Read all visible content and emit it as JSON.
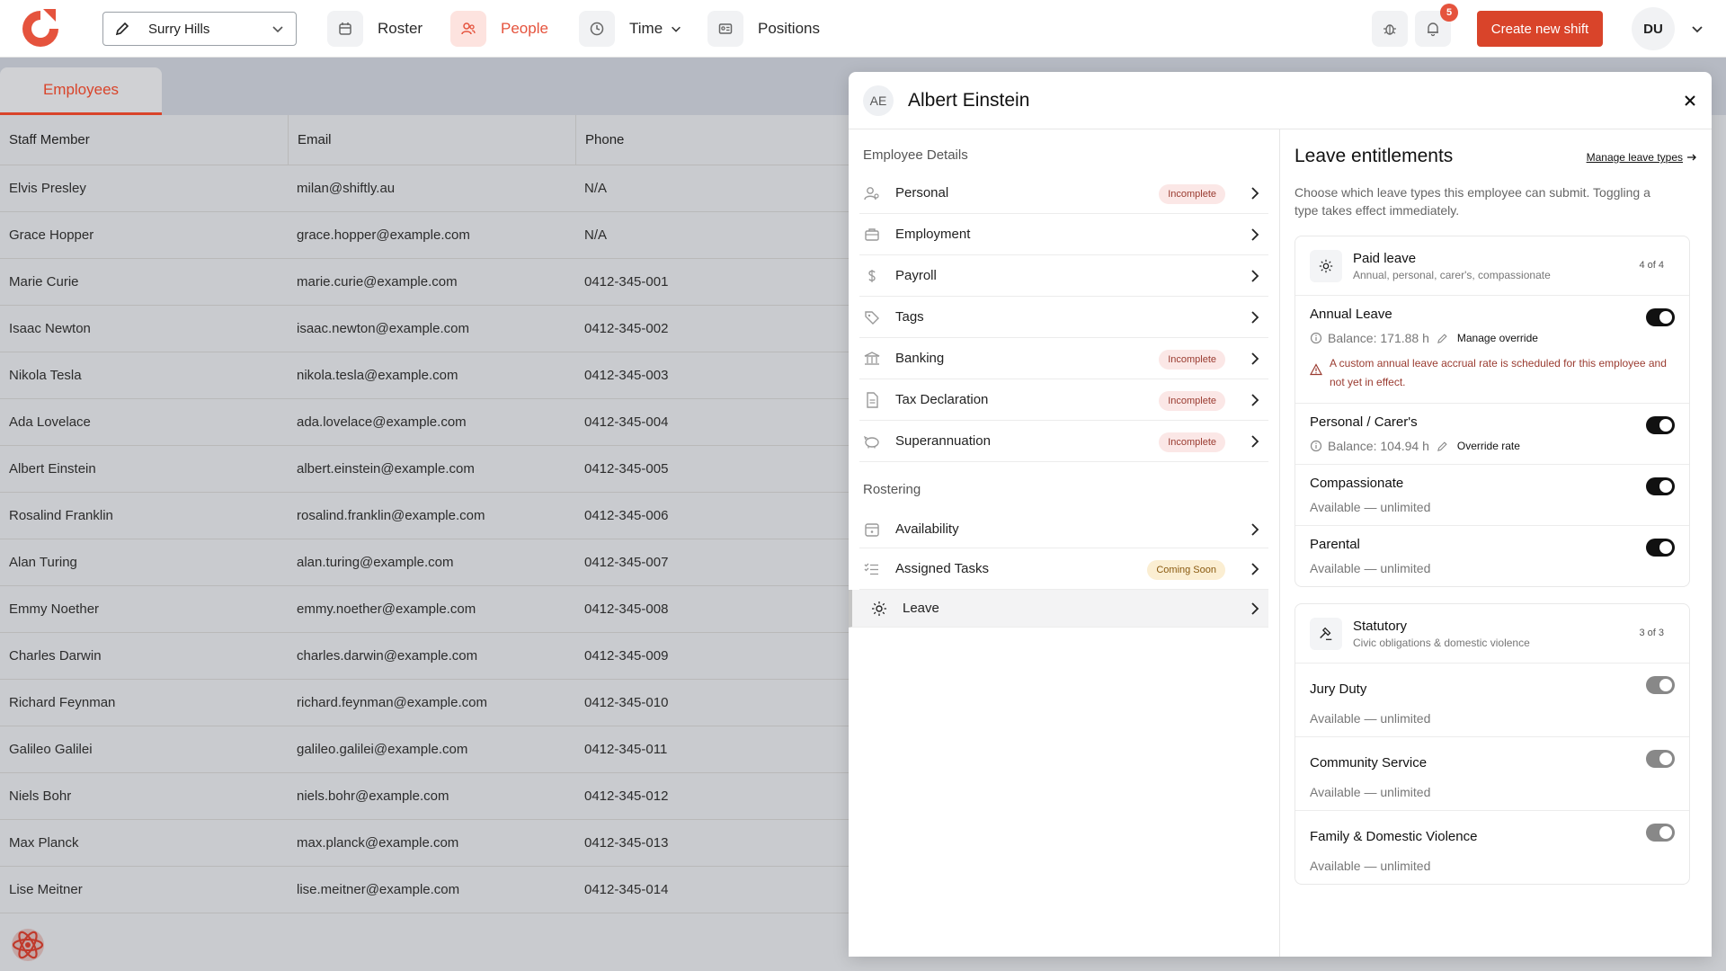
{
  "header": {
    "location": "Surry Hills",
    "nav": [
      {
        "label": "Roster",
        "icon": "calendar-icon"
      },
      {
        "label": "People",
        "icon": "people-icon"
      },
      {
        "label": "Time",
        "icon": "clock-icon"
      },
      {
        "label": "Positions",
        "icon": "id-card-icon"
      }
    ],
    "notifications_count": "5",
    "create_label": "Create new shift",
    "user_initials": "DU"
  },
  "tab": "Employees",
  "table": {
    "columns": [
      "Staff Member",
      "Email",
      "Phone"
    ],
    "rows": [
      [
        "Elvis Presley",
        "milan@shiftly.au",
        "N/A"
      ],
      [
        "Grace Hopper",
        "grace.hopper@example.com",
        "N/A"
      ],
      [
        "Marie Curie",
        "marie.curie@example.com",
        "0412-345-001"
      ],
      [
        "Isaac Newton",
        "isaac.newton@example.com",
        "0412-345-002"
      ],
      [
        "Nikola Tesla",
        "nikola.tesla@example.com",
        "0412-345-003"
      ],
      [
        "Ada Lovelace",
        "ada.lovelace@example.com",
        "0412-345-004"
      ],
      [
        "Albert Einstein",
        "albert.einstein@example.com",
        "0412-345-005"
      ],
      [
        "Rosalind Franklin",
        "rosalind.franklin@example.com",
        "0412-345-006"
      ],
      [
        "Alan Turing",
        "alan.turing@example.com",
        "0412-345-007"
      ],
      [
        "Emmy Noether",
        "emmy.noether@example.com",
        "0412-345-008"
      ],
      [
        "Charles Darwin",
        "charles.darwin@example.com",
        "0412-345-009"
      ],
      [
        "Richard Feynman",
        "richard.feynman@example.com",
        "0412-345-010"
      ],
      [
        "Galileo Galilei",
        "galileo.galilei@example.com",
        "0412-345-011"
      ],
      [
        "Niels Bohr",
        "niels.bohr@example.com",
        "0412-345-012"
      ],
      [
        "Max Planck",
        "max.planck@example.com",
        "0412-345-013"
      ],
      [
        "Lise Meitner",
        "lise.meitner@example.com",
        "0412-345-014"
      ]
    ]
  },
  "panel": {
    "initials": "AE",
    "name": "Albert Einstein",
    "details_title": "Employee Details",
    "details": [
      {
        "label": "Personal",
        "icon": "user-icon",
        "status": "Incomplete"
      },
      {
        "label": "Employment",
        "icon": "briefcase-icon",
        "status": ""
      },
      {
        "label": "Payroll",
        "icon": "dollar-icon",
        "status": ""
      },
      {
        "label": "Tags",
        "icon": "tag-icon",
        "status": ""
      },
      {
        "label": "Banking",
        "icon": "bank-icon",
        "status": "Incomplete"
      },
      {
        "label": "Tax Declaration",
        "icon": "document-icon",
        "status": "Incomplete"
      },
      {
        "label": "Superannuation",
        "icon": "piggy-bank-icon",
        "status": "Incomplete"
      }
    ],
    "rostering_title": "Rostering",
    "rostering": [
      {
        "label": "Availability",
        "icon": "calendar-icon",
        "status": ""
      },
      {
        "label": "Assigned Tasks",
        "icon": "checklist-icon",
        "status": "Coming Soon"
      },
      {
        "label": "Leave",
        "icon": "sun-icon",
        "status": ""
      }
    ],
    "leave": {
      "title": "Leave entitlements",
      "manage_link": "Manage leave types",
      "description": "Choose which leave types this employee can submit. Toggling a type takes effect immediately.",
      "paid": {
        "title": "Paid leave",
        "subtitle": "Annual, personal, carer's, compassionate",
        "count": "4 of 4",
        "items": {
          "annual": {
            "name": "Annual Leave",
            "balance": "Balance: 171.88 h",
            "action": "Manage override",
            "warning": "A custom annual leave accrual rate is scheduled for this employee and not yet in effect.",
            "enabled": true
          },
          "personal": {
            "name": "Personal / Carer's",
            "balance": "Balance: 104.94 h",
            "action": "Override rate",
            "enabled": true
          },
          "compassionate": {
            "name": "Compassionate",
            "note": "Available — unlimited",
            "enabled": true
          },
          "parental": {
            "name": "Parental",
            "note": "Available — unlimited",
            "enabled": true
          }
        }
      },
      "statutory": {
        "title": "Statutory",
        "subtitle": "Civic obligations & domestic violence",
        "count": "3 of 3",
        "items": {
          "jury": {
            "name": "Jury Duty",
            "note": "Available — unlimited",
            "enabled": true
          },
          "community": {
            "name": "Community Service",
            "note": "Available — unlimited",
            "enabled": true
          },
          "family": {
            "name": "Family & Domestic Violence",
            "note": "Available — unlimited",
            "enabled": true
          }
        }
      }
    }
  },
  "colors": {
    "accent": "#d9442a",
    "accent_soft": "#fde3df",
    "overlay": "#c9cbcf"
  }
}
